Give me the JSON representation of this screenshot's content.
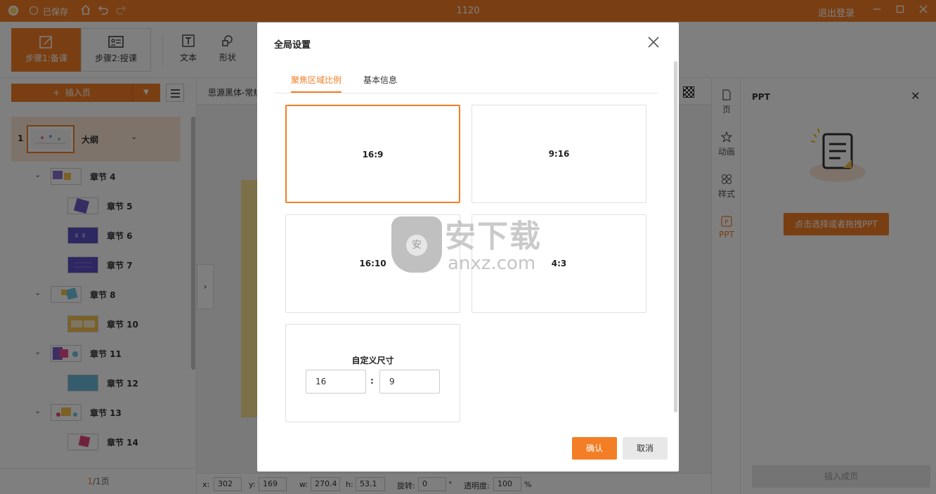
{
  "titlebar": {
    "saved": "已保存",
    "doc_title": "1120",
    "logout": "退出登录"
  },
  "toolbar": {
    "step1": "步骤1:备课",
    "step2": "步骤2:授课",
    "text_tool": "文本",
    "shape_tool": "形状"
  },
  "left_panel": {
    "insert_page": "插入页",
    "outline": {
      "num": "1",
      "label": "大纲"
    },
    "sections": [
      {
        "label": "章节 4",
        "level": 1
      },
      {
        "label": "章节 5",
        "level": 2
      },
      {
        "label": "章节 6",
        "level": 2
      },
      {
        "label": "章节 7",
        "level": 2
      },
      {
        "label": "章节 8",
        "level": 1
      },
      {
        "label": "章节 10",
        "level": 2
      },
      {
        "label": "章节 11",
        "level": 1
      },
      {
        "label": "章节 12",
        "level": 2
      },
      {
        "label": "章节 13",
        "level": 1
      },
      {
        "label": "章节 14",
        "level": 2
      }
    ],
    "page_current": "1",
    "page_total": "/1页"
  },
  "canvas": {
    "font_name": "思源黑体-常规"
  },
  "statusbar": {
    "x_label": "x:",
    "x_value": "302",
    "y_label": "y:",
    "y_value": "169",
    "w_label": "w:",
    "w_value": "270.4",
    "h_label": "h:",
    "h_value": "53.1",
    "rotate_label": "旋转:",
    "rotate_value": "0",
    "rotate_unit": "°",
    "opacity_label": "透明度:",
    "opacity_value": "100",
    "opacity_unit": "%"
  },
  "right_tabs": [
    {
      "label": "页",
      "icon": "page-icon"
    },
    {
      "label": "动画",
      "icon": "star-icon"
    },
    {
      "label": "样式",
      "icon": "grid-icon"
    },
    {
      "label": "PPT",
      "icon": "ppt-icon"
    }
  ],
  "ppt_panel": {
    "title": "PPT",
    "pick_button": "点击选择或者拖拽PPT",
    "insert_done": "插入成页"
  },
  "modal": {
    "title": "全局设置",
    "tabs": [
      "聚焦区域比例",
      "基本信息"
    ],
    "ratios": [
      "16:9",
      "9:16",
      "16:10",
      "4:3"
    ],
    "selected_ratio": "16:9",
    "custom": {
      "label": "自定义尺寸",
      "width": "16",
      "colon": ":",
      "height": "9"
    },
    "confirm": "确认",
    "cancel": "取消"
  },
  "watermark": {
    "cn": "安下载",
    "en": "anxz.com",
    "shield_char": "安"
  },
  "colors": {
    "accent": "#f37e26",
    "overlay": "rgba(0,0,0,0.5)"
  }
}
